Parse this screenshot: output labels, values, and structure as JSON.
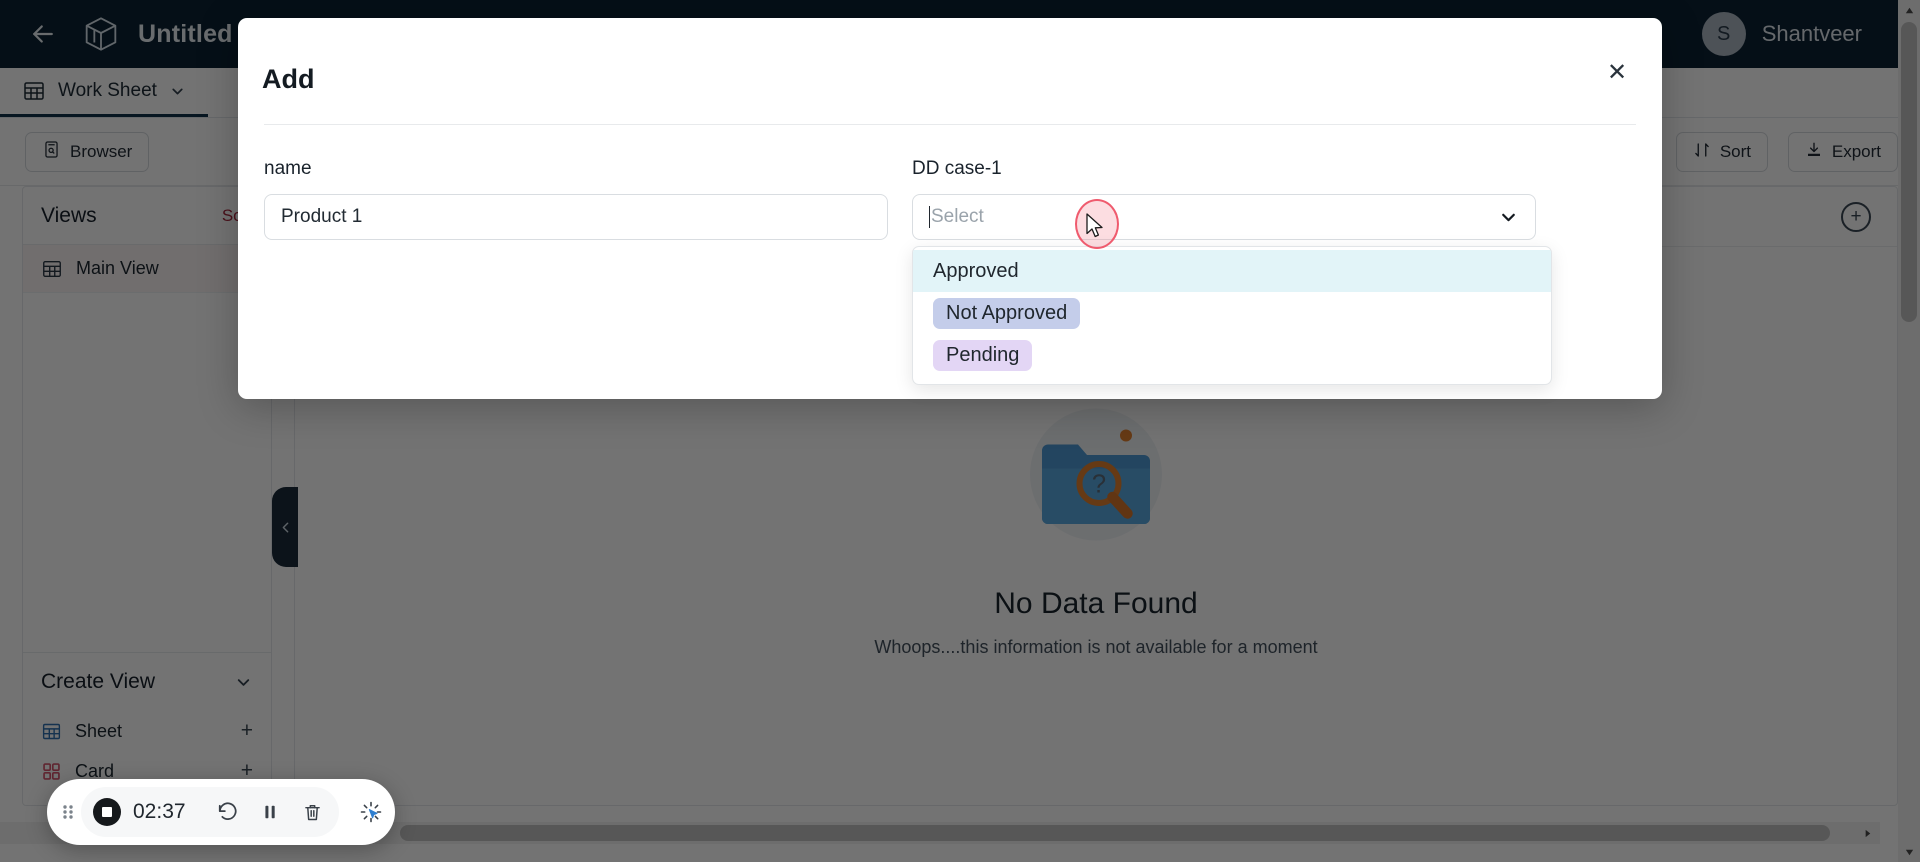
{
  "topbar": {
    "back_icon": "arrow-left-icon",
    "logo_icon": "cube-logo-icon",
    "title": "Untitled Sche",
    "user_initial": "S",
    "user_name": "Shantveer"
  },
  "tabstrip": {
    "active_tab": "Work Sheet",
    "tab_icon": "grid-icon",
    "caret_icon": "chevron-down-icon"
  },
  "toolbar": {
    "browser_label": "Browser",
    "browser_icon": "browser-icon",
    "sort_label": "Sort",
    "sort_icon": "sort-icon",
    "export_label": "Export",
    "export_icon": "download-icon"
  },
  "sidebar": {
    "views_title": "Views",
    "views_sort_label": "Sort",
    "view_items": [
      {
        "label": "Main View",
        "icon": "grid-icon"
      }
    ],
    "create_view": {
      "title": "Create View",
      "caret_icon": "chevron-down-icon",
      "items": [
        {
          "label": "Sheet",
          "icon": "grid-icon",
          "action": "+"
        },
        {
          "label": "Card",
          "icon": "card-icon",
          "action": "+"
        }
      ]
    },
    "collapse_icon": "chevron-left-icon"
  },
  "content": {
    "add_icon": "plus-circle-icon",
    "empty_title": "No Data Found",
    "empty_subtitle": "Whoops....this information is not available for a moment",
    "empty_art_icon": "folder-search-icon"
  },
  "modal": {
    "title": "Add",
    "close_icon": "close-icon",
    "fields": {
      "name": {
        "label": "name",
        "value": "Product 1",
        "placeholder": ""
      },
      "dd_case": {
        "label": "DD case-1",
        "placeholder": "Select",
        "value": "",
        "chevron_icon": "chevron-down-icon",
        "options": [
          {
            "label": "Approved",
            "style": "row-highlight",
            "bg": "#e2f4f8",
            "highlighted": true
          },
          {
            "label": "Not Approved",
            "style": "chip",
            "bg": "#c4cdea",
            "highlighted": false
          },
          {
            "label": "Pending",
            "style": "chip",
            "bg": "#e3d6f5",
            "highlighted": false
          }
        ]
      }
    }
  },
  "recorder": {
    "drag_icon": "drag-handle-icon",
    "stop_icon": "stop-record-icon",
    "time": "02:37",
    "restart_icon": "restart-icon",
    "pause_icon": "pause-icon",
    "delete_icon": "trash-icon",
    "magic_cursor_icon": "cursor-sparkle-icon"
  },
  "scrollbars": {
    "h_right_arrow": "chevron-right-icon",
    "v_up_arrow": "chevron-up-icon",
    "v_down_arrow": "chevron-down-icon"
  },
  "colors": {
    "topbar_bg": "#0c2233",
    "accent_red": "#a4253b",
    "click_ring": "#ef5b6e",
    "option_approved_bg": "#e2f4f8",
    "option_not_approved_bg": "#c4cdea",
    "option_pending_bg": "#e3d6f5"
  }
}
